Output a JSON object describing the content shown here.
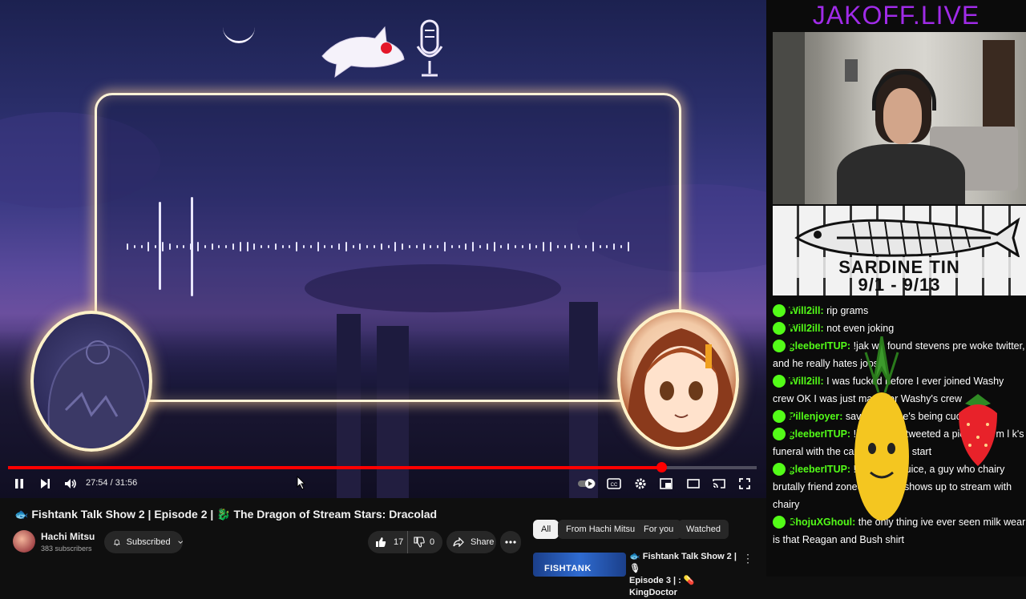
{
  "video": {
    "time_display": "27:54 / 31:56",
    "progress": 0.873,
    "title": "🐟 Fishtank Talk Show 2 | Episode 2 | 🐉 The Dragon of Stream Stars: Dracolad",
    "channel_name": "Hachi Mitsu",
    "subscribers": "383 subscribers",
    "subscribed_label": "Subscribed",
    "like_count": "17",
    "dislike_count": "0",
    "share_label": "Share"
  },
  "chips": [
    "All",
    "From Hachi Mitsu",
    "For you",
    "Watched"
  ],
  "recommendation": {
    "thumb_text": "FISHTANK",
    "title_line1": "🐟 Fishtank Talk Show 2 | 🎙",
    "title_line2": "Episode 3 | : 💊 KingDoctor"
  },
  "stream": {
    "site_title": "JAKOFF.LIVE",
    "banner_title": "SARDINE TIN",
    "banner_dates": "9/1 - 9/13"
  },
  "chat": [
    {
      "user": "Will2ill:",
      "text": " rip grams"
    },
    {
      "user": "Will2ill:",
      "text": " not even joking"
    },
    {
      "user": "gleeberITUP:",
      "text": " !jak we found stevens pre woke twitter, and he really hates joos"
    },
    {
      "user": "Will2ill:",
      "text": " I was fucked before I ever joined Washy crew OK I was just made for Washy's crew"
    },
    {
      "user": "Pillenjoyer:",
      "text": " save grace he's being cucked rn"
    },
    {
      "user": "gleeberITUP:",
      "text": " !jak Steven tweeted a picture of m l k's funeral with the caption a good start"
    },
    {
      "user": "gleeberITUP:",
      "text": " !jak This is juice, a guy who chairy brutally friend zoned who still shows up to stream with chairy"
    },
    {
      "user": "ShojuXGhoul:",
      "text": " the only thing ive ever seen milk wear is that Reagan and Bush shirt"
    }
  ],
  "colors": {
    "kick_green": "#53fc18",
    "site_title": "#a02be8",
    "progress_red": "#ff0000",
    "frame_glow": "#fff3d6"
  },
  "icons": [
    "pause-icon",
    "next-icon",
    "volume-icon",
    "autoplay-toggle",
    "captions-icon",
    "settings-gear-icon",
    "miniplayer-icon",
    "theater-icon",
    "cast-icon",
    "fullscreen-icon",
    "bell-icon",
    "chevron-down-icon",
    "thumbs-up-icon",
    "thumbs-down-icon",
    "share-arrow-icon",
    "more-dots-icon",
    "mouse-pointer-icon"
  ]
}
